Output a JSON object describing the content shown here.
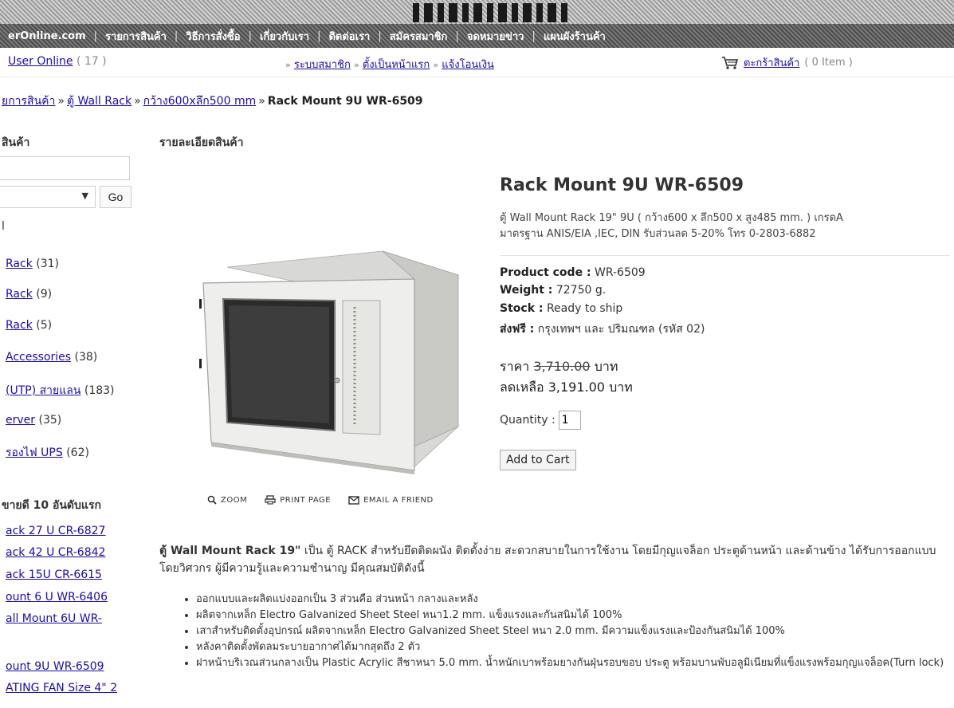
{
  "nav": {
    "items": [
      "erOnline.com",
      "รายการสินค้า",
      "วิธีการสั่งซื้อ",
      "เกี่ยวกับเรา",
      "ติดต่อเรา",
      "สมัครสมาชิก",
      "จดหมายข่าว",
      "แผนผังร้านค้า"
    ]
  },
  "status": {
    "user_online_label": "User Online",
    "user_online_count": "( 17 )",
    "member_links": [
      "ระบบสมาชิก",
      "ตั้งเป็นหน้าแรก",
      "แจ้งโอนเงิน"
    ],
    "cart_label": "ตะกร้าสินค้า",
    "cart_count": "( 0 Item )"
  },
  "breadcrumb": {
    "items": [
      "ยการสินค้า",
      "ตู้ Wall Rack",
      "กว้าง600xลึก500 mm"
    ],
    "current": "Rack Mount 9U WR-6509"
  },
  "sidebar": {
    "search_heading": "สินค้า",
    "go_label": "Go",
    "cat_heading": "l",
    "categories": [
      {
        "name": "Rack",
        "count": "(31)"
      },
      {
        "name": "Rack",
        "count": "(9)"
      },
      {
        "name": "Rack",
        "count": "(5)"
      },
      {
        "name": "Accessories",
        "count": "(38)"
      },
      {
        "name": "(UTP) สายแลน",
        "count": "(183)"
      },
      {
        "name": "erver",
        "count": "(35)"
      },
      {
        "name": "รองไฟ UPS",
        "count": "(62)"
      }
    ],
    "best_heading": "ขายดี 10 อันดับแรก",
    "best_items": [
      "ack 27 U CR-6827",
      "ack 42 U CR-6842",
      "ack 15U CR-6615",
      "ount 6 U WR-6406",
      "all Mount 6U WR-",
      "ount 9U WR-6509",
      "ATING FAN Size 4\" 2"
    ]
  },
  "main": {
    "detail_heading": "รายละเอียดสินค้า",
    "tools": {
      "zoom": "ZOOM",
      "print": "PRINT PAGE",
      "email": "EMAIL A FRIEND"
    },
    "title": "Rack Mount 9U WR-6509",
    "desc_line1": "ตู้ Wall Mount Rack 19\" 9U ( กว้าง600 x ลึก500 x สูง485 mm. ) เกรดA",
    "desc_line2": "มาตรฐาน ANIS/EIA ,IEC, DIN รับส่วนลด 5-20% โทร 0-2803-6882",
    "product_code_label": "Product code :",
    "product_code": "WR-6509",
    "weight_label": "Weight :",
    "weight": "72750 g.",
    "stock_label": "Stock :",
    "stock": "Ready to ship",
    "shipping_label": "ส่งฟรี :",
    "shipping": "กรุงเทพฯ และ ปริมณฑล (รหัส 02)",
    "price_label": "ราคา",
    "old_price": "3,710.00",
    "currency": "บาท",
    "sale_label": "ลดเหลือ",
    "sale_price": "3,191.00",
    "qty_label": "Quantity :",
    "qty_value": "1",
    "add_to_cart": "Add to Cart",
    "long_desc_bold": "ตู้ Wall Mount Rack 19\"",
    "long_desc": " เป็น ตู้ RACK สำหรับยึดติดผนัง ติดตั้งง่าย สะดวกสบายในการใช้งาน โดยมีกุญแจล็อก ประตูด้านหน้า และด้านข้าง ได้รับการออกแบบโดยวิศวกร ผู้มีความรู้และความชำนาญ มีคุณสมบัติดังนี้",
    "features": [
      "ออกแบบและผลิตแบ่งออกเป็น 3 ส่วนคือ ส่วนหน้า กลางและหลัง",
      "ผลิตจากเหล็ก Electro Galvanized Sheet Steel หนา1.2 mm. แข็งแรงและกันสนิมได้ 100%",
      "เสาสำหรับติดตั้งอุปกรณ์ ผลิตจากเหล็ก Electro Galvanized Sheet Steel หนา 2.0 mm. มีความแข็งแรงและป้องกันสนิมได้ 100%",
      "หลังคาติดตั้งพัดลมระบายอากาศได้มากสุดถึง 2 ตัว",
      "ฝาหน้าบริเวณส่วนกลางเป็น Plastic Acrylic สีชาหนา 5.0 mm. น้ำหนักเบาพร้อมยางกันฝุ่นรอบขอบ ประตู พร้อมบานพับอลูมิเนียมที่แข็งแรงพร้อมกุญแจล็อค(Turn lock)"
    ]
  }
}
